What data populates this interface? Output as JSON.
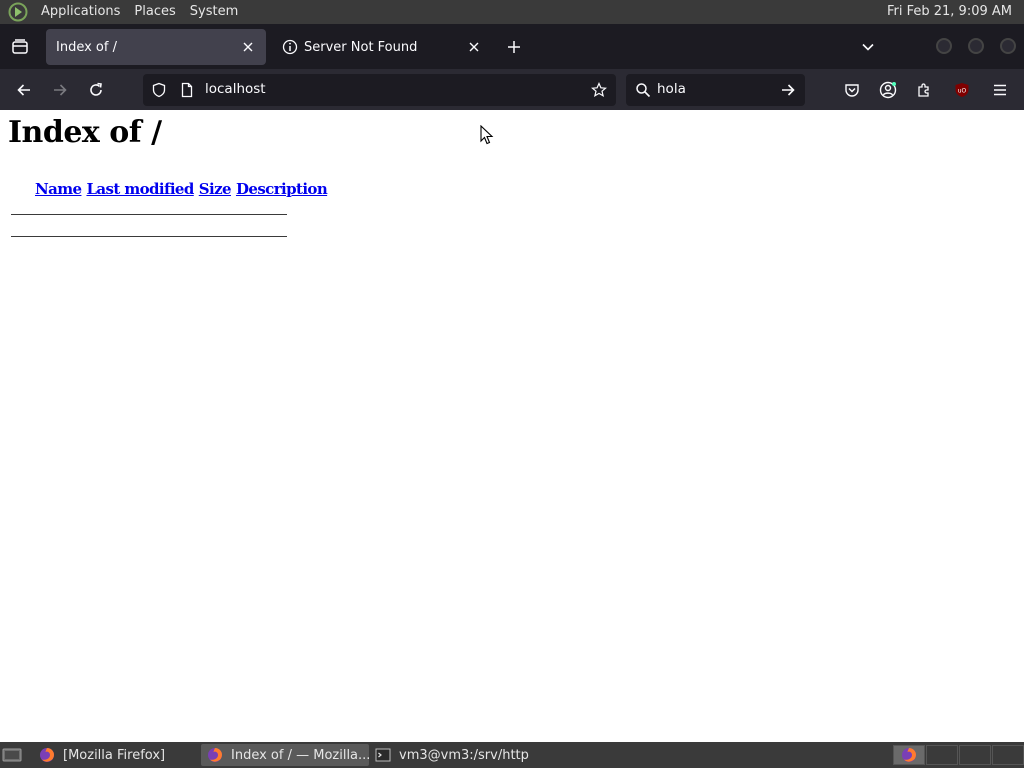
{
  "top_panel": {
    "menus": [
      "Applications",
      "Places",
      "System"
    ],
    "clock": "Fri Feb 21,  9:09 AM"
  },
  "browser": {
    "tabs": [
      {
        "title": "Index of /",
        "active": true
      },
      {
        "title": "Server Not Found",
        "active": false
      }
    ],
    "url": "localhost",
    "search_query": "hola"
  },
  "page": {
    "heading": "Index of /",
    "columns": [
      "Name",
      "Last modified",
      "Size",
      "Description"
    ]
  },
  "taskbar": {
    "tasks": [
      {
        "label": "[Mozilla Firefox]",
        "icon": "firefox-icon"
      },
      {
        "label": "Index of / — Mozilla...",
        "icon": "firefox-icon"
      },
      {
        "label": "vm3@vm3:/srv/http",
        "icon": "terminal-icon"
      }
    ]
  },
  "colors": {
    "panel_bg": "#3a3a3a",
    "tabstrip_bg": "#1c1b22",
    "toolbar_bg": "#2b2a33",
    "link": "#0000ee"
  }
}
